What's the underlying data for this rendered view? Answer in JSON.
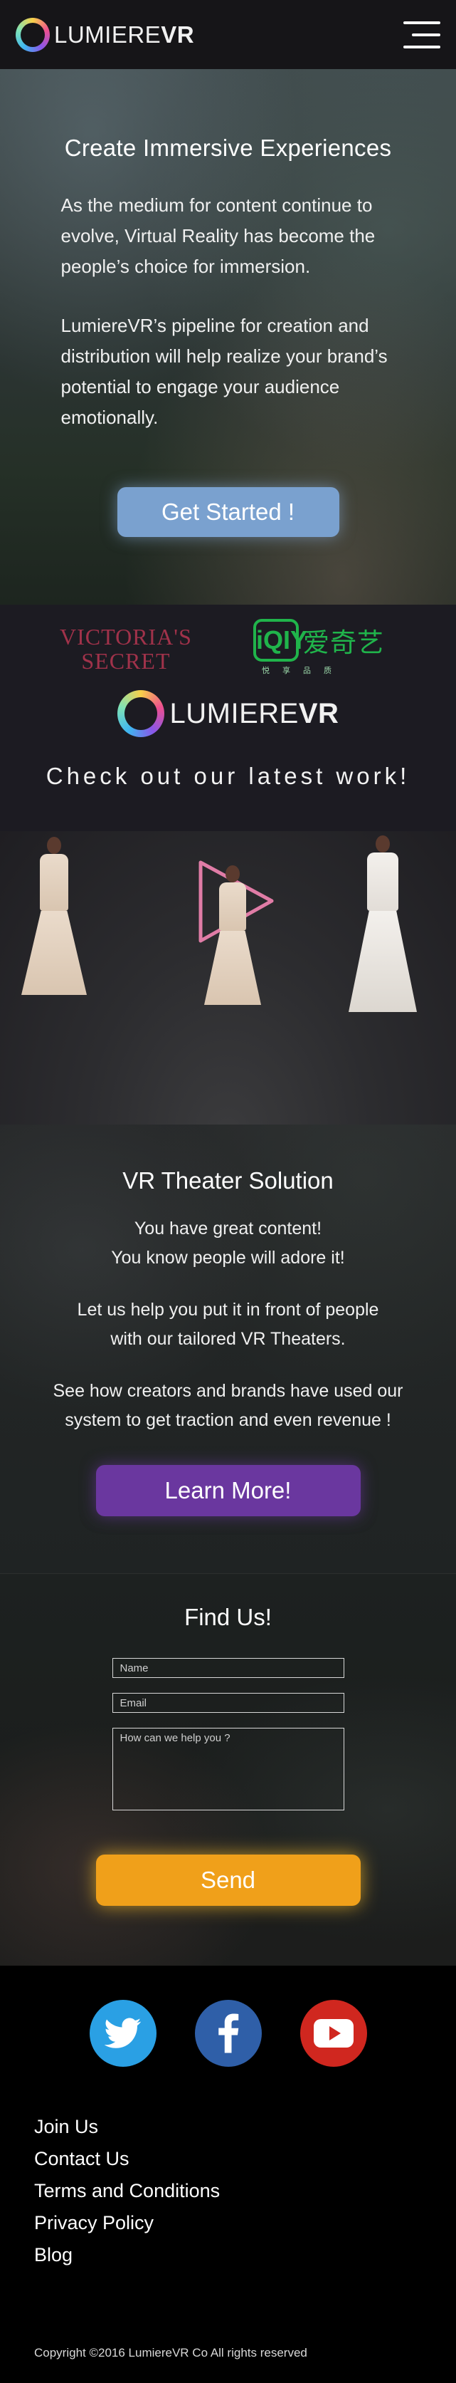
{
  "header": {
    "logo_text_light": "LUMIERE",
    "logo_text_bold": "VR",
    "menu_icon": "hamburger-menu-icon"
  },
  "hero": {
    "title": "Create Immersive Experiences",
    "paragraph_1": "As the medium for content continue to evolve, Virtual Reality has become the people’s choice for immersion.",
    "paragraph_2": "LumiereVR’s pipeline for creation and distribution will help realize your brand’s potential to engage your audience emotionally.",
    "cta_label": "Get Started !",
    "cta_color": "#7aa1cf"
  },
  "partners": {
    "victorias_secret_line1": "VICTORIA'S",
    "victorias_secret_line2": "SECRET",
    "iqiyi_box": "iQIY",
    "iqiyi_chinese": "爱奇艺",
    "iqiyi_sub": "悦享品质",
    "logo_text_light": "LUMIERE",
    "logo_text_bold": "VR",
    "latest_work": "Check out our latest work!",
    "play_icon": "play-icon",
    "play_color": "#e07ca6"
  },
  "theater": {
    "title": "VR Theater Solution",
    "line_1": "You have great content!",
    "line_2": "You know people will adore it!",
    "line_3": "Let us help you put it in front of people",
    "line_4": "with our tailored VR  Theaters.",
    "line_5": "See how creators and brands have used our",
    "line_6": "system to get traction and even revenue !",
    "cta_label": "Learn More!",
    "cta_color": "#6a379f"
  },
  "contact": {
    "title": "Find Us!",
    "name_placeholder": "Name",
    "email_placeholder": "Email",
    "message_placeholder": "How can we help you ?",
    "name_value": "",
    "email_value": "",
    "message_value": "",
    "send_label": "Send",
    "send_color": "#f0a01a"
  },
  "footer": {
    "social": [
      {
        "name": "twitter",
        "icon": "twitter-bird-icon",
        "color": "#2aa0e4"
      },
      {
        "name": "facebook",
        "icon": "facebook-f-icon",
        "color": "#2f5fa8"
      },
      {
        "name": "youtube",
        "icon": "youtube-play-icon",
        "color": "#d0271f"
      }
    ],
    "links": [
      "Join Us",
      "Contact Us",
      "Terms and Conditions",
      "Privacy Policy",
      "Blog"
    ],
    "copyright": "Copyright ©2016 LumiereVR Co All rights reserved"
  }
}
